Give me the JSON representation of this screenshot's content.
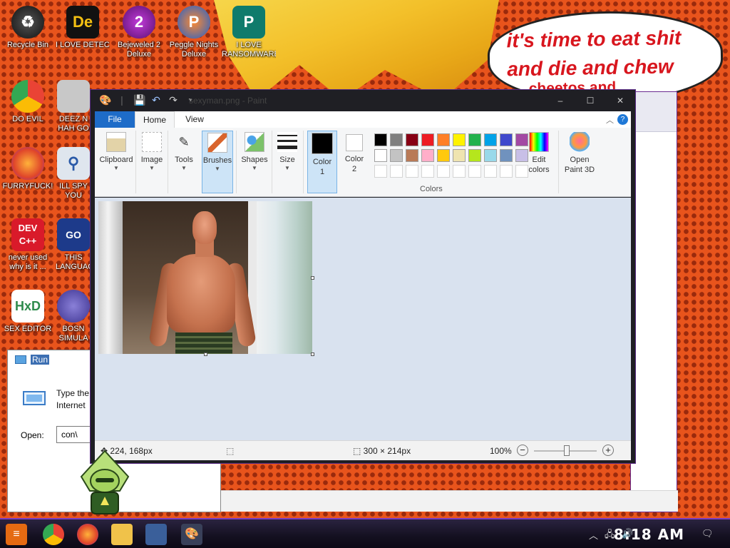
{
  "wallpaper": {
    "speech_lines": [
      "it's time to eat shit",
      "and die and chew",
      "cheetos and"
    ]
  },
  "desktop_icons": [
    {
      "label": "Recycle Bin",
      "icon": "recycle-bin-icon"
    },
    {
      "label": "I LOVE DETECTING...",
      "icon": "detect-it-easy-icon"
    },
    {
      "label": "Bejeweled 2 Deluxe",
      "icon": "bejeweled-icon"
    },
    {
      "label": "Peggle Nights Deluxe",
      "icon": "peggle-icon"
    },
    {
      "label": "I LOVE RANSOMWARE",
      "icon": "publisher-icon"
    },
    {
      "label": "DO EVIL",
      "icon": "chrome-icon"
    },
    {
      "label": "DEEZ N HAH GO",
      "icon": "files-icon"
    },
    {
      "label": "FURRYFUCK!",
      "icon": "firefox-icon"
    },
    {
      "label": "ILL SPY YOU",
      "icon": "spy-icon"
    },
    {
      "label": "never used why is it ...",
      "icon": "devcpp-icon"
    },
    {
      "label": "THIS LANGUAGE",
      "icon": "go-icon"
    },
    {
      "label": "SEX EDITOR",
      "icon": "hxd-icon"
    },
    {
      "label": "BOSN SIMULA",
      "icon": "mace-icon"
    }
  ],
  "paint": {
    "title": "sexyman.png - Paint",
    "tabs": {
      "file": "File",
      "home": "Home",
      "view": "View"
    },
    "help": "?",
    "groups": {
      "clipboard": "Clipboard",
      "image": "Image",
      "tools": "Tools",
      "brushes": "Brushes",
      "shapes": "Shapes",
      "size": "Size",
      "color1": [
        "Color",
        "1"
      ],
      "color2": [
        "Color",
        "2"
      ],
      "edit_colors": [
        "Edit",
        "colors"
      ],
      "open_paint3d": [
        "Open",
        "Paint 3D"
      ],
      "colors": "Colors"
    },
    "palette_row1": [
      "#000000",
      "#7f7f7f",
      "#880015",
      "#ed1c24",
      "#ff7f27",
      "#fff200",
      "#22b14c",
      "#00a2e8",
      "#3f48cc",
      "#a349a4"
    ],
    "palette_row2": [
      "#ffffff",
      "#c3c3c3",
      "#b97a57",
      "#ffaec9",
      "#ffc90e",
      "#efe4b0",
      "#b5e61d",
      "#99d9ea",
      "#7092be",
      "#c8bfe7"
    ],
    "color1_value": "#000000",
    "color2_value": "#ffffff",
    "status": {
      "cursor_pos": "224, 168px",
      "image_size": "300 × 214px",
      "zoom": "100%",
      "zoom_fraction": 0.5
    }
  },
  "run": {
    "title": "Run",
    "message_lines": [
      "Type the",
      "Internet"
    ],
    "open_label": "Open:",
    "input_value": "con\\"
  },
  "taskbar": {
    "clock": "8:18 AM"
  }
}
